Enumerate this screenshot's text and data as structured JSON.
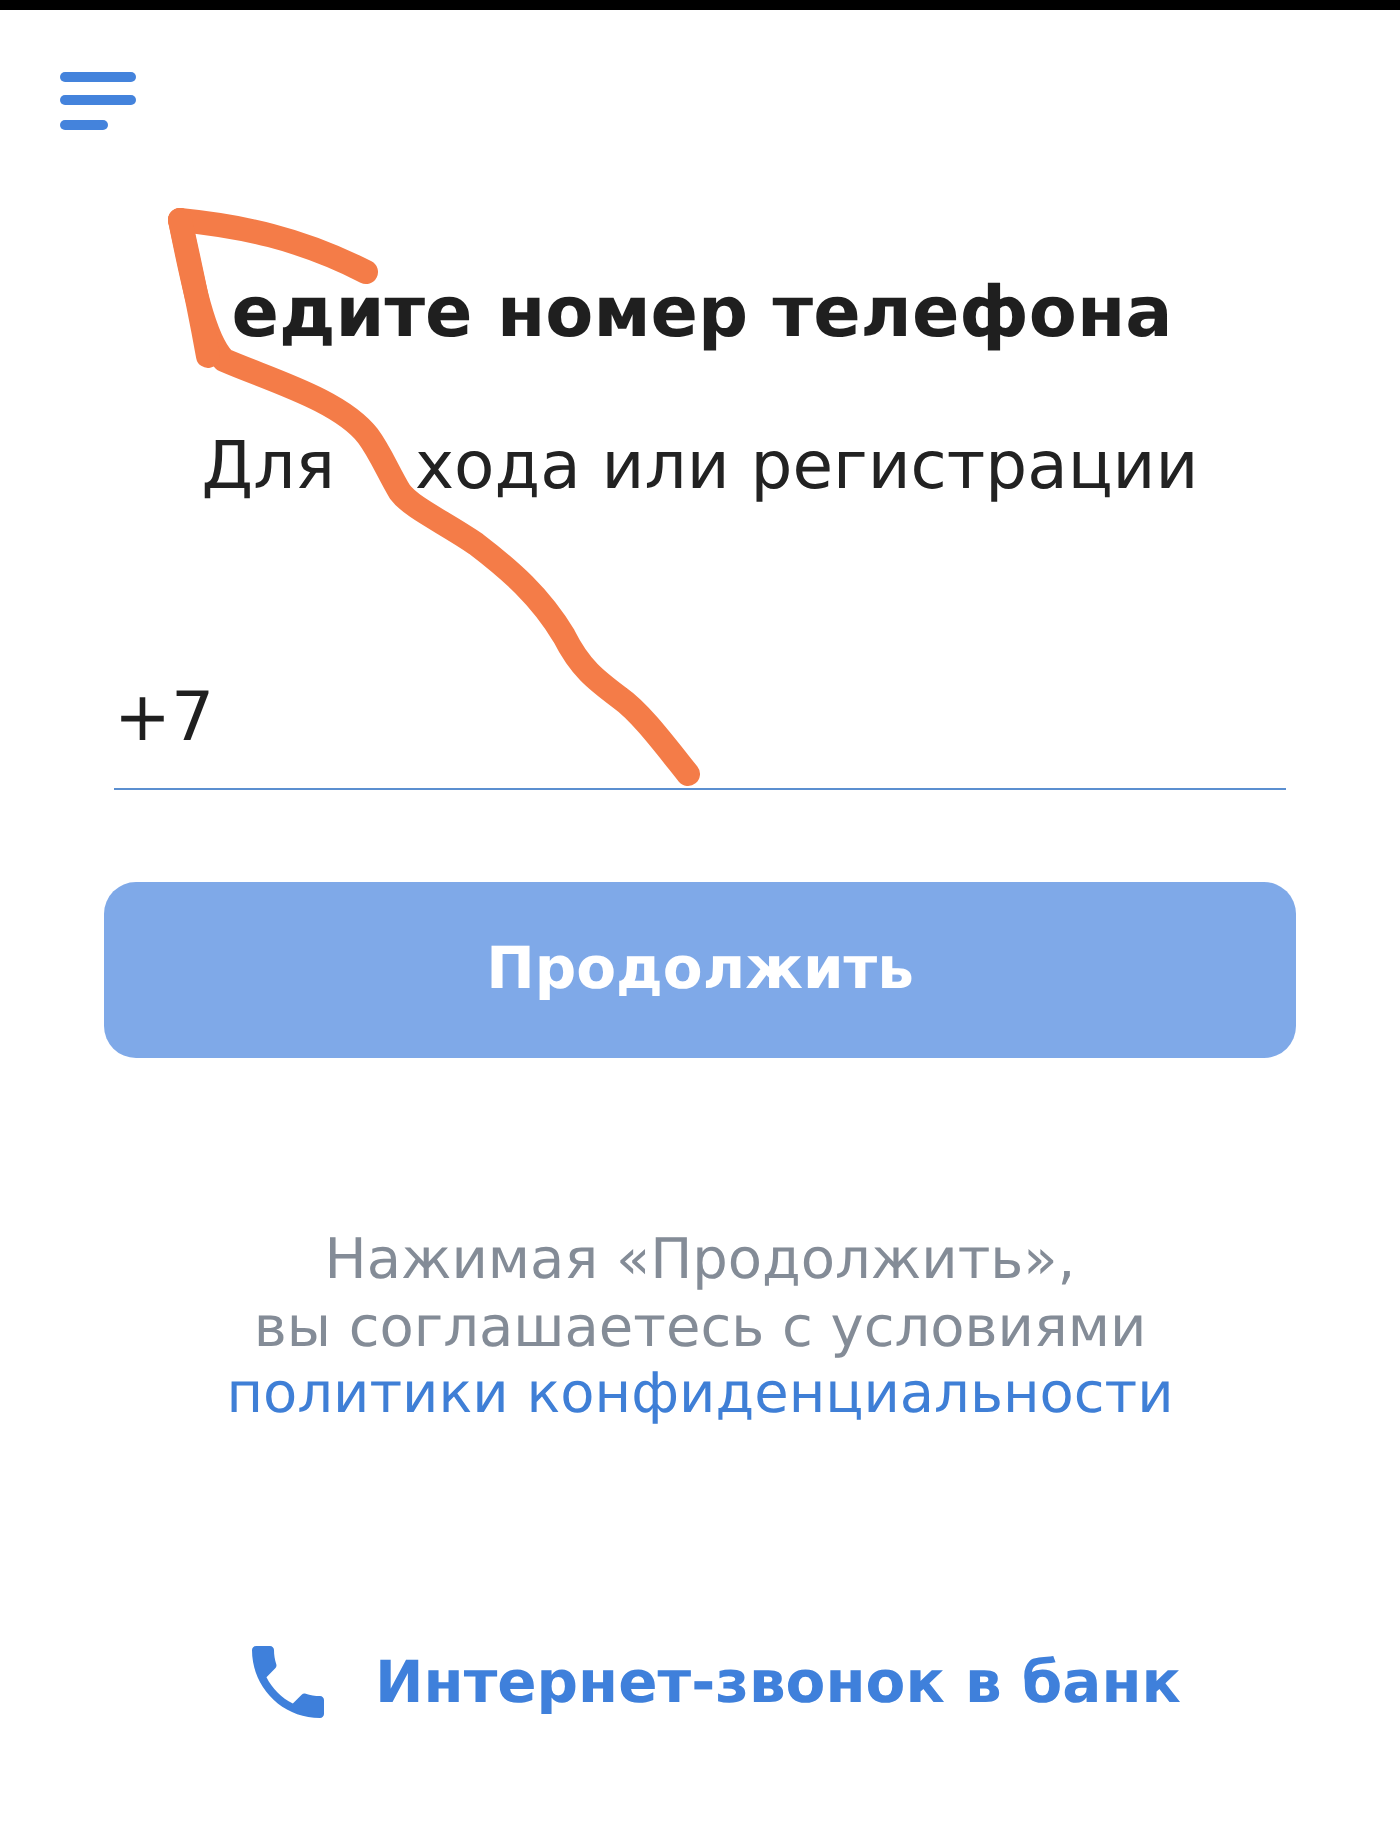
{
  "title": "едите номер телефона",
  "subtitle_parts": [
    "Для",
    "хода или регистрации"
  ],
  "phone_field": {
    "value": "+7"
  },
  "continue_button": {
    "label": "Продолжить",
    "disabled": true
  },
  "consent": {
    "lines": [
      "Нажимая «Продолжить»,",
      "вы соглашаетесь с условиями"
    ],
    "link": "политики конфиденциальности"
  },
  "call_link": {
    "label": "Интернет-звонок в банк"
  }
}
